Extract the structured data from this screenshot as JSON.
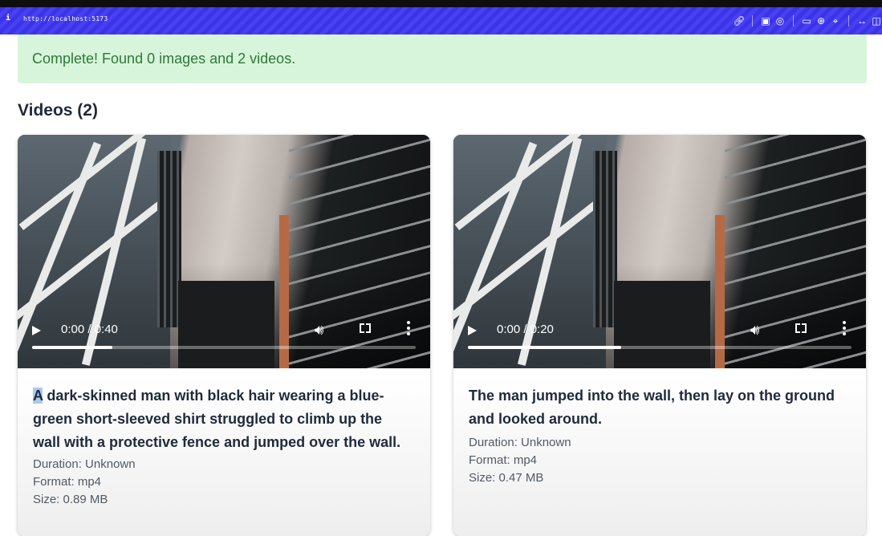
{
  "browser": {
    "info_icon": "info-icon",
    "url": "http://localhost:5173",
    "toolbar_icons": [
      "link-icon",
      "screenshot-icon",
      "camera-icon",
      "window-icon",
      "globe-icon",
      "crosshair-icon",
      "code-icon",
      "panel-icon"
    ]
  },
  "status": {
    "message": "Complete! Found 0 images and 2 videos.",
    "color": "#2d7a36",
    "background": "#d7f5db"
  },
  "videos_section": {
    "title": "Videos (2)"
  },
  "videos": [
    {
      "time_display": "0:00 / 0:40",
      "progress": 0.21,
      "description_first": "A",
      "description_rest": " dark-skinned man with black hair wearing a blue-green short-sleeved shirt struggled to climb up the wall with a protective fence and jumped over the wall.",
      "duration": "Duration: Unknown",
      "format": "Format: mp4",
      "size": "Size: 0.89 MB"
    },
    {
      "time_display": "0:00 / 0:20",
      "progress": 0.4,
      "description_first": "",
      "description_rest": "The man jumped into the wall, then lay on the ground and looked around.",
      "duration": "Duration: Unknown",
      "format": "Format: mp4",
      "size": "Size: 0.47 MB"
    }
  ]
}
